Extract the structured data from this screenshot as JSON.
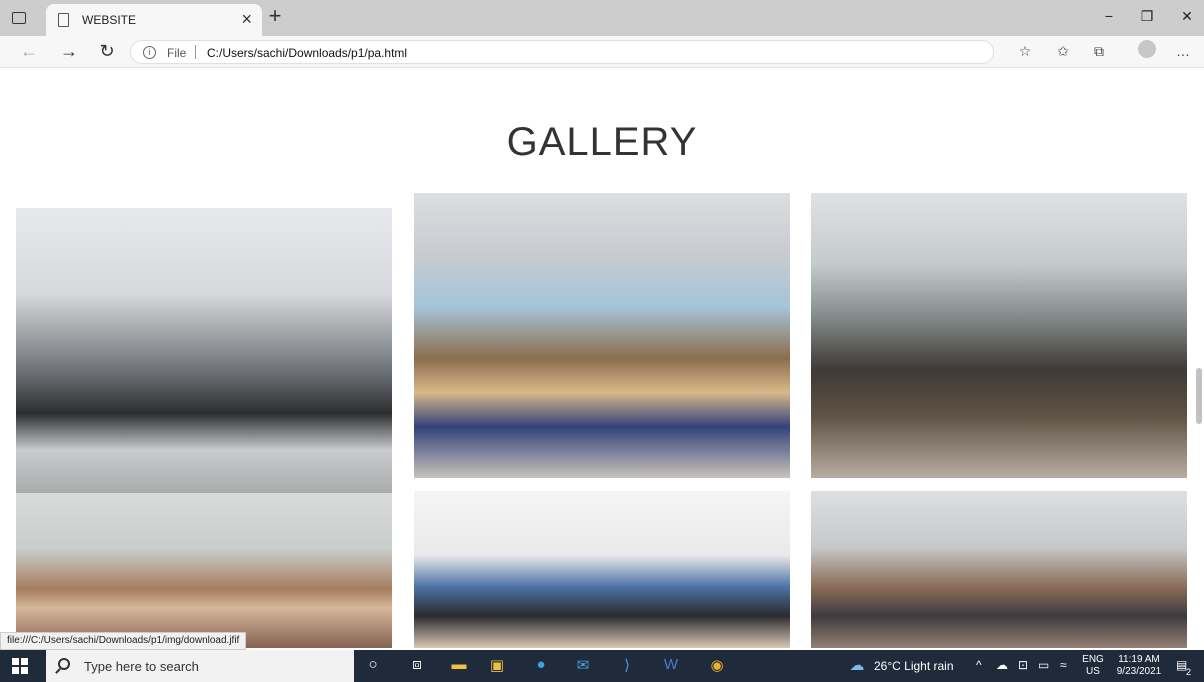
{
  "browser": {
    "tab_title": "WEBSITE",
    "tab_close": "×",
    "new_tab": "+",
    "file_label": "File",
    "url": "C:/Users/sachi/Downloads/p1/pa.html",
    "window_controls": [
      "−",
      "❐",
      "✕"
    ]
  },
  "page": {
    "heading": "GALLERY",
    "photos": [
      {
        "name": "gallery-photo-computer-lab"
      },
      {
        "name": "gallery-photo-classroom"
      },
      {
        "name": "gallery-photo-lecture-hall"
      },
      {
        "name": "gallery-photo-seminar"
      },
      {
        "name": "gallery-photo-group-work"
      },
      {
        "name": "gallery-photo-auditorium"
      }
    ],
    "status_url": "file:///C:/Users/sachi/Downloads/p1/img/download.jfif"
  },
  "taskbar": {
    "search_placeholder": "Type here to search",
    "weather": "26°C  Light rain",
    "lang_top": "ENG",
    "lang_bottom": "US",
    "time": "11:19 AM",
    "date": "9/23/2021",
    "notification_count": "2"
  }
}
